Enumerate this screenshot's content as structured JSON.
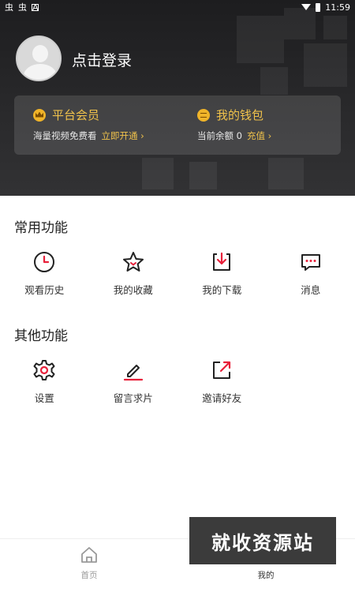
{
  "status_bar": {
    "left_icons": [
      "bug-icon",
      "bug-icon",
      "notification-icon"
    ],
    "left_text": [
      "虫",
      "虫"
    ],
    "time": "11:59"
  },
  "header": {
    "login_text": "点击登录",
    "member": {
      "title": "平台会员",
      "desc": "海量视频免费看",
      "link": "立即开通 ›"
    },
    "wallet": {
      "title": "我的钱包",
      "desc": "当前余额 0",
      "link": "充值 ›"
    }
  },
  "common_functions": {
    "title": "常用功能",
    "items": [
      {
        "label": "观看历史",
        "icon": "clock-icon"
      },
      {
        "label": "我的收藏",
        "icon": "star-icon"
      },
      {
        "label": "我的下载",
        "icon": "download-icon"
      },
      {
        "label": "消息",
        "icon": "message-icon"
      }
    ]
  },
  "other_functions": {
    "title": "其他功能",
    "items": [
      {
        "label": "设置",
        "icon": "gear-icon"
      },
      {
        "label": "留言求片",
        "icon": "edit-icon"
      },
      {
        "label": "邀请好友",
        "icon": "share-icon"
      }
    ]
  },
  "bottom_nav": {
    "items": [
      {
        "label": "首页",
        "icon": "home-icon",
        "active": false
      },
      {
        "label": "我的",
        "icon": "user-icon",
        "active": true
      }
    ]
  },
  "watermark": "就收资源站",
  "colors": {
    "accent": "#e8203a",
    "gold": "#f0c24b",
    "header_bg": "#1d1d1f"
  }
}
